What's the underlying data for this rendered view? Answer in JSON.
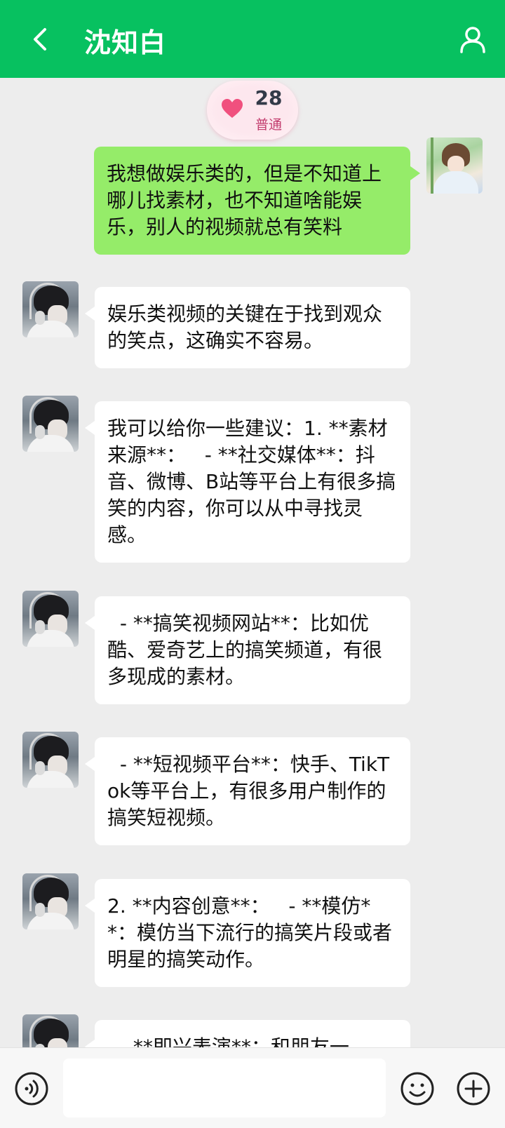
{
  "header": {
    "title": "沈知白",
    "back_icon": "back-arrow-icon",
    "profile_icon": "user-profile-icon",
    "accent_color": "#07c160"
  },
  "intimacy": {
    "value": "28",
    "level": "普通",
    "icon": "heart-icon",
    "heart_color": "#f0507e"
  },
  "messages": [
    {
      "sender": "me",
      "text": "我想做娱乐类的，但是不知道上哪儿找素材，也不知道啥能娱乐，别人的视频就总有笑料"
    },
    {
      "sender": "bot",
      "text": "娱乐类视频的关键在于找到观众的笑点，这确实不容易。"
    },
    {
      "sender": "bot",
      "text": "我可以给你一些建议：1. **素材来源**：   - **社交媒体**：抖音、微博、B站等平台上有很多搞笑的内容，你可以从中寻找灵感。"
    },
    {
      "sender": "bot",
      "text": "  - **搞笑视频网站**：比如优酷、爱奇艺上的搞笑频道，有很多现成的素材。"
    },
    {
      "sender": "bot",
      "text": "  - **短视频平台**：快手、TikTok等平台上，有很多用户制作的搞笑短视频。"
    },
    {
      "sender": "bot",
      "text": "2. **内容创意**：   - **模仿**：模仿当下流行的搞笑片段或者明星的搞笑动作。"
    },
    {
      "sender": "bot",
      "text": "  - **即兴表演**：和朋友一"
    }
  ],
  "input": {
    "value": "",
    "placeholder": "",
    "voice_icon": "voice-input-icon",
    "emoji_icon": "emoji-icon",
    "more_icon": "plus-icon"
  },
  "colors": {
    "outgoing_bubble": "#95ec69",
    "incoming_bubble": "#ffffff",
    "background": "#ededed"
  }
}
